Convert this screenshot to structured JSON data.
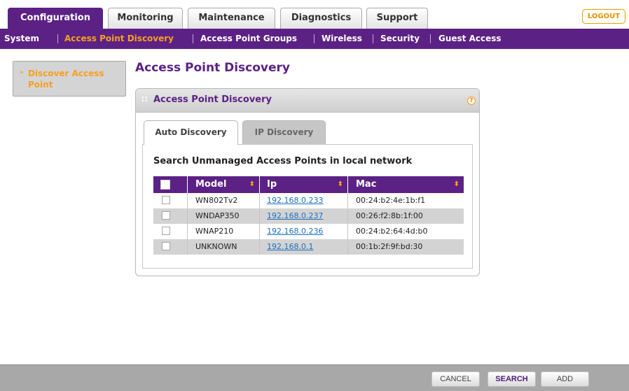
{
  "top_tabs": [
    {
      "label": "Configuration",
      "active": true
    },
    {
      "label": "Monitoring",
      "active": false
    },
    {
      "label": "Maintenance",
      "active": false
    },
    {
      "label": "Diagnostics",
      "active": false
    },
    {
      "label": "Support",
      "active": false
    }
  ],
  "logout_label": "LOGOUT",
  "subnav": [
    {
      "label": "System",
      "active": false
    },
    {
      "label": "Access Point Discovery",
      "active": true
    },
    {
      "label": "Access Point Groups",
      "active": false
    },
    {
      "label": "Wireless",
      "active": false
    },
    {
      "label": "Security",
      "active": false
    },
    {
      "label": "Guest Access",
      "active": false
    }
  ],
  "left_menu": {
    "arrow": "»",
    "item": "Discover Access Point"
  },
  "page_title": "Access Point Discovery",
  "panel": {
    "title": "Access Point Discovery",
    "help": "?",
    "tabs": [
      {
        "label": "Auto Discovery",
        "active": true
      },
      {
        "label": "IP Discovery",
        "active": false
      }
    ],
    "section_title": "Search Unmanaged Access Points in local network",
    "table": {
      "columns": [
        "Model",
        "Ip",
        "Mac"
      ],
      "sort_icon": "⬍",
      "rows": [
        {
          "model": "WN802Tv2",
          "ip": "192.168.0.233",
          "mac": "00:24:b2:4e:1b:f1"
        },
        {
          "model": "WNDAP350",
          "ip": "192.168.0.237",
          "mac": "00:26:f2:8b:1f:00"
        },
        {
          "model": "WNAP210",
          "ip": "192.168.0.236",
          "mac": "00:24:b2:64:4d:b0"
        },
        {
          "model": "UNKNOWN",
          "ip": "192.168.0.1",
          "mac": "00:1b:2f:9f:bd:30"
        }
      ]
    }
  },
  "buttons": {
    "cancel": "CANCEL",
    "search": "SEARCH",
    "add": "ADD"
  }
}
